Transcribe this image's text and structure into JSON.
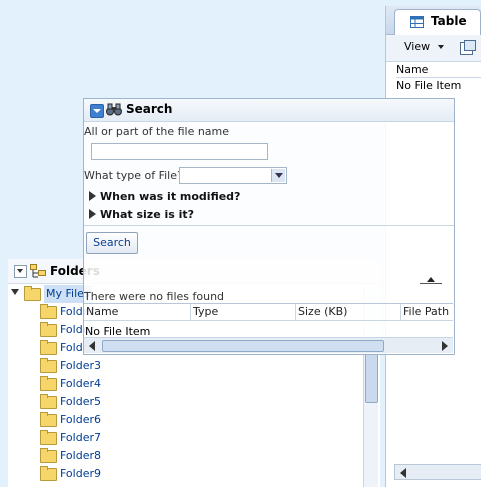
{
  "table_panel": {
    "tab_label": "Table",
    "view_menu_label": "View",
    "column_name": "Name",
    "empty_text": "No File Item"
  },
  "folder_panel": {
    "title": "Folders",
    "root": "My Files",
    "folders": [
      "Folder",
      "Folder",
      "Folder",
      "Folder3",
      "Folder4",
      "Folder5",
      "Folder6",
      "Folder7",
      "Folder8",
      "Folder9"
    ]
  },
  "search": {
    "title": "Search",
    "filename_label": "All or part of the file name",
    "filename_value": "",
    "filetype_label": "What type of File?",
    "filetype_value": "",
    "modified_label": "When was it modified?",
    "size_label": "What size is it?",
    "search_button": "Search",
    "status_text": "There were no files found",
    "columns": [
      "Name",
      "Type",
      "Size (KB)",
      "File Path"
    ],
    "empty_text": "No File Item"
  },
  "colors": {
    "background": "#e3f1fc",
    "accent": "#3e7fcf",
    "link": "#003d8f"
  }
}
